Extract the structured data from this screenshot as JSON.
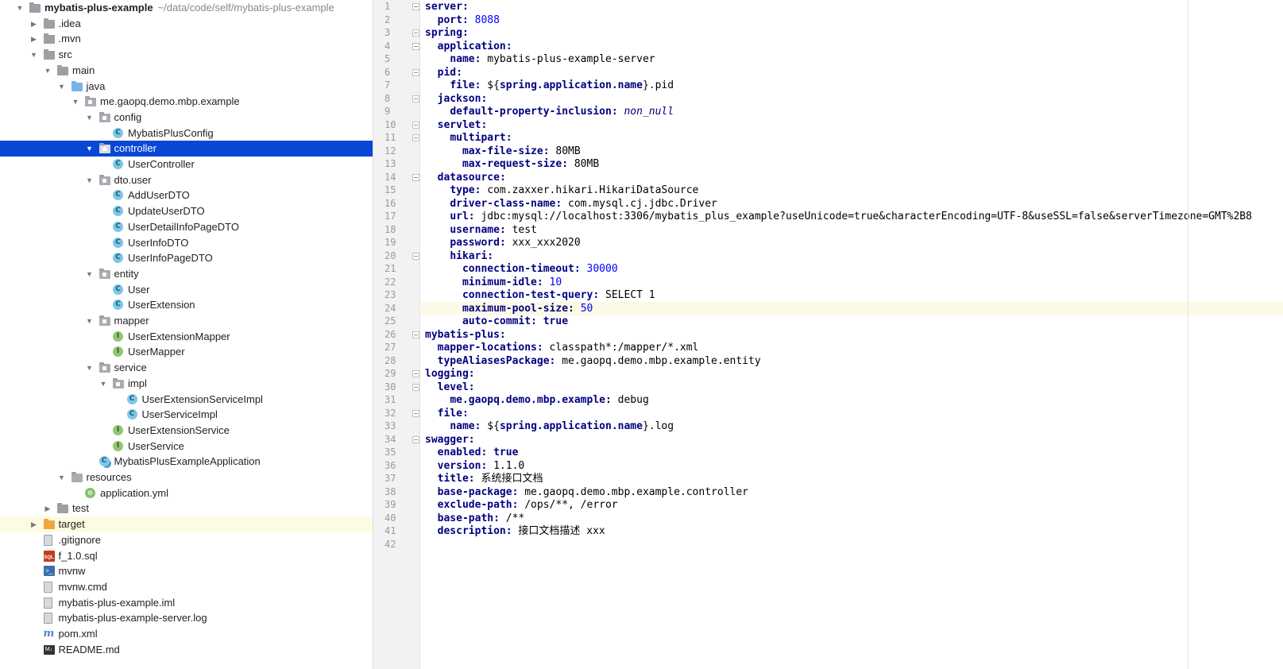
{
  "project": {
    "name": "mybatis-plus-example",
    "path": "~/data/code/self/mybatis-plus-example"
  },
  "tree": [
    {
      "label": "mybatis-plus-example",
      "depth": 0,
      "arrow": "down",
      "icon": "folder",
      "bold": true,
      "path": "~/data/code/self/mybatis-plus-example"
    },
    {
      "label": ".idea",
      "depth": 1,
      "arrow": "right",
      "icon": "folder"
    },
    {
      "label": ".mvn",
      "depth": 1,
      "arrow": "right",
      "icon": "folder"
    },
    {
      "label": "src",
      "depth": 1,
      "arrow": "down",
      "icon": "folder"
    },
    {
      "label": "main",
      "depth": 2,
      "arrow": "down",
      "icon": "folder"
    },
    {
      "label": "java",
      "depth": 3,
      "arrow": "down",
      "icon": "folder-blue"
    },
    {
      "label": "me.gaopq.demo.mbp.example",
      "depth": 4,
      "arrow": "down",
      "icon": "package"
    },
    {
      "label": "config",
      "depth": 5,
      "arrow": "down",
      "icon": "package"
    },
    {
      "label": "MybatisPlusConfig",
      "depth": 6,
      "icon": "class"
    },
    {
      "label": "controller",
      "depth": 5,
      "arrow": "down",
      "icon": "package",
      "selected": true
    },
    {
      "label": "UserController",
      "depth": 6,
      "icon": "class"
    },
    {
      "label": "dto.user",
      "depth": 5,
      "arrow": "down",
      "icon": "package"
    },
    {
      "label": "AddUserDTO",
      "depth": 6,
      "icon": "class"
    },
    {
      "label": "UpdateUserDTO",
      "depth": 6,
      "icon": "class"
    },
    {
      "label": "UserDetailInfoPageDTO",
      "depth": 6,
      "icon": "class"
    },
    {
      "label": "UserInfoDTO",
      "depth": 6,
      "icon": "class"
    },
    {
      "label": "UserInfoPageDTO",
      "depth": 6,
      "icon": "class"
    },
    {
      "label": "entity",
      "depth": 5,
      "arrow": "down",
      "icon": "package"
    },
    {
      "label": "User",
      "depth": 6,
      "icon": "class"
    },
    {
      "label": "UserExtension",
      "depth": 6,
      "icon": "class"
    },
    {
      "label": "mapper",
      "depth": 5,
      "arrow": "down",
      "icon": "package"
    },
    {
      "label": "UserExtensionMapper",
      "depth": 6,
      "icon": "interface"
    },
    {
      "label": "UserMapper",
      "depth": 6,
      "icon": "interface"
    },
    {
      "label": "service",
      "depth": 5,
      "arrow": "down",
      "icon": "package"
    },
    {
      "label": "impl",
      "depth": 6,
      "arrow": "down",
      "icon": "package"
    },
    {
      "label": "UserExtensionServiceImpl",
      "depth": 7,
      "icon": "class"
    },
    {
      "label": "UserServiceImpl",
      "depth": 7,
      "icon": "class"
    },
    {
      "label": "UserExtensionService",
      "depth": 6,
      "icon": "interface"
    },
    {
      "label": "UserService",
      "depth": 6,
      "icon": "interface"
    },
    {
      "label": "MybatisPlusExampleApplication",
      "depth": 5,
      "icon": "app"
    },
    {
      "label": "resources",
      "depth": 3,
      "arrow": "down",
      "icon": "folder-res"
    },
    {
      "label": "application.yml",
      "depth": 4,
      "icon": "yml"
    },
    {
      "label": "test",
      "depth": 2,
      "arrow": "right",
      "icon": "folder"
    },
    {
      "label": "target",
      "depth": 1,
      "arrow": "right",
      "icon": "folder-orange",
      "highlight": true
    },
    {
      "label": ".gitignore",
      "depth": 1,
      "icon": "file"
    },
    {
      "label": "f_1.0.sql",
      "depth": 1,
      "icon": "sql"
    },
    {
      "label": "mvnw",
      "depth": 1,
      "icon": "terminal"
    },
    {
      "label": "mvnw.cmd",
      "depth": 1,
      "icon": "file"
    },
    {
      "label": "mybatis-plus-example.iml",
      "depth": 1,
      "icon": "file"
    },
    {
      "label": "mybatis-plus-example-server.log",
      "depth": 1,
      "icon": "file"
    },
    {
      "label": "pom.xml",
      "depth": 1,
      "icon": "maven"
    },
    {
      "label": "README.md",
      "depth": 1,
      "icon": "markdown"
    }
  ],
  "editor": {
    "current_line": 24,
    "lines": [
      {
        "n": 1,
        "indent": 0,
        "key": "server",
        "fold": true
      },
      {
        "n": 2,
        "indent": 1,
        "key": "port",
        "value": "8088",
        "vtype": "num"
      },
      {
        "n": 3,
        "indent": 0,
        "key": "spring",
        "fold": true
      },
      {
        "n": 4,
        "indent": 1,
        "key": "application",
        "fold": true
      },
      {
        "n": 5,
        "indent": 2,
        "key": "name",
        "value": "mybatis-plus-example-server"
      },
      {
        "n": 6,
        "indent": 1,
        "key": "pid",
        "fold": true
      },
      {
        "n": 7,
        "indent": 2,
        "key": "file",
        "tmpl_pre": "${",
        "tmpl": "spring.application.name",
        "tmpl_post": "}.pid"
      },
      {
        "n": 8,
        "indent": 1,
        "key": "jackson",
        "fold": true
      },
      {
        "n": 9,
        "indent": 2,
        "key": "default-property-inclusion",
        "value": "non_null",
        "vtype": "ital"
      },
      {
        "n": 10,
        "indent": 1,
        "key": "servlet",
        "fold": true
      },
      {
        "n": 11,
        "indent": 2,
        "key": "multipart",
        "fold": true
      },
      {
        "n": 12,
        "indent": 3,
        "key": "max-file-size",
        "value": "80MB"
      },
      {
        "n": 13,
        "indent": 3,
        "key": "max-request-size",
        "value": "80MB"
      },
      {
        "n": 14,
        "indent": 1,
        "key": "datasource",
        "fold": true
      },
      {
        "n": 15,
        "indent": 2,
        "key": "type",
        "value": "com.zaxxer.hikari.HikariDataSource"
      },
      {
        "n": 16,
        "indent": 2,
        "key": "driver-class-name",
        "value": "com.mysql.cj.jdbc.Driver"
      },
      {
        "n": 17,
        "indent": 2,
        "key": "url",
        "value": "jdbc:mysql://localhost:3306/mybatis_plus_example?useUnicode=true&characterEncoding=UTF-8&useSSL=false&serverTimezone=GMT%2B8"
      },
      {
        "n": 18,
        "indent": 2,
        "key": "username",
        "value": "test"
      },
      {
        "n": 19,
        "indent": 2,
        "key": "password",
        "value": "xxx_xxx2020"
      },
      {
        "n": 20,
        "indent": 2,
        "key": "hikari",
        "fold": true
      },
      {
        "n": 21,
        "indent": 3,
        "key": "connection-timeout",
        "value": "30000",
        "vtype": "num"
      },
      {
        "n": 22,
        "indent": 3,
        "key": "minimum-idle",
        "value": "10",
        "vtype": "num"
      },
      {
        "n": 23,
        "indent": 3,
        "key": "connection-test-query",
        "value": "SELECT 1"
      },
      {
        "n": 24,
        "indent": 3,
        "key": "maximum-pool-size",
        "value": "50",
        "vtype": "num"
      },
      {
        "n": 25,
        "indent": 3,
        "key": "auto-commit",
        "value": "true",
        "vtype": "bool"
      },
      {
        "n": 26,
        "indent": 0,
        "key": "mybatis-plus",
        "fold": true
      },
      {
        "n": 27,
        "indent": 1,
        "key": "mapper-locations",
        "value": "classpath*:/mapper/*.xml"
      },
      {
        "n": 28,
        "indent": 1,
        "key": "typeAliasesPackage",
        "value": "me.gaopq.demo.mbp.example.entity"
      },
      {
        "n": 29,
        "indent": 0,
        "key": "logging",
        "fold": true
      },
      {
        "n": 30,
        "indent": 1,
        "key": "level",
        "fold": true
      },
      {
        "n": 31,
        "indent": 2,
        "key": "me.gaopq.demo.mbp.example",
        "value": "debug"
      },
      {
        "n": 32,
        "indent": 1,
        "key": "file",
        "fold": true
      },
      {
        "n": 33,
        "indent": 2,
        "key": "name",
        "tmpl_pre": "${",
        "tmpl": "spring.application.name",
        "tmpl_post": "}.log"
      },
      {
        "n": 34,
        "indent": 0,
        "key": "swagger",
        "fold": true
      },
      {
        "n": 35,
        "indent": 1,
        "key": "enabled",
        "value": "true",
        "vtype": "bool"
      },
      {
        "n": 36,
        "indent": 1,
        "key": "version",
        "value": "1.1.0"
      },
      {
        "n": 37,
        "indent": 1,
        "key": "title",
        "value": "系统接口文档"
      },
      {
        "n": 38,
        "indent": 1,
        "key": "base-package",
        "value": "me.gaopq.demo.mbp.example.controller"
      },
      {
        "n": 39,
        "indent": 1,
        "key": "exclude-path",
        "value": "/ops/**, /error"
      },
      {
        "n": 40,
        "indent": 1,
        "key": "base-path",
        "value": "/**"
      },
      {
        "n": 41,
        "indent": 1,
        "key": "description",
        "value": "接口文档描述 xxx"
      },
      {
        "n": 42,
        "indent": 0
      }
    ]
  }
}
